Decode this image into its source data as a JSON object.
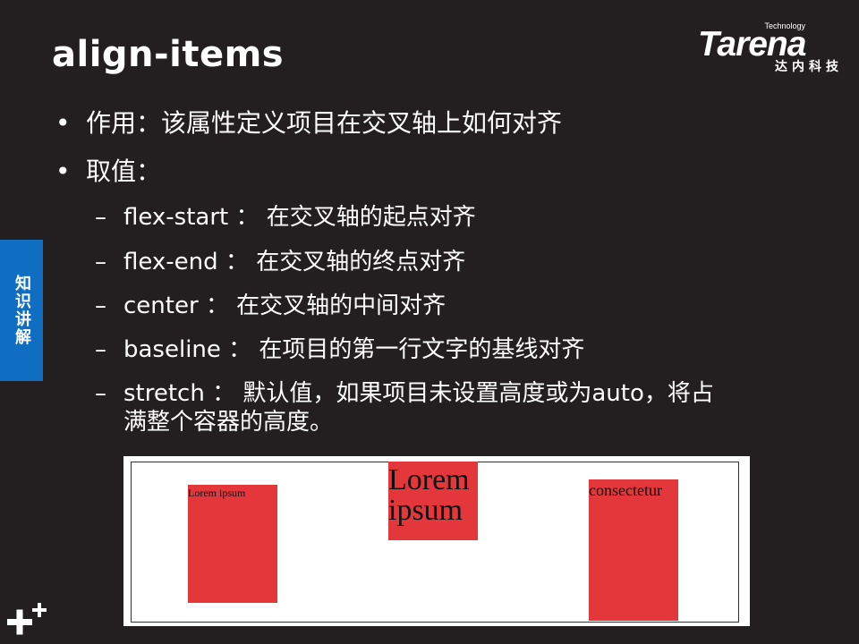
{
  "title": "align-items",
  "logo": {
    "word": "Tarena",
    "tagline": "Technology",
    "cn": "达内科技"
  },
  "sidetab": "知识讲解",
  "bullets": [
    {
      "marker": "•",
      "text": "作用：该属性定义项目在交叉轴上如何对齐"
    },
    {
      "marker": "•",
      "text": "取值："
    }
  ],
  "subitems": [
    {
      "marker": "–",
      "text": "flex-start ： 在交叉轴的起点对齐"
    },
    {
      "marker": "–",
      "text": "flex-end ： 在交叉轴的终点对齐"
    },
    {
      "marker": "–",
      "text": "center ： 在交叉轴的中间对齐"
    },
    {
      "marker": "–",
      "text": "baseline ： 在项目的第一行文字的基线对齐"
    },
    {
      "marker": "–",
      "text": "stretch ： 默认值，如果项目未设置高度或为auto，将占",
      "cont": "满整个容器的高度。"
    }
  ],
  "demo": {
    "items": [
      "Lorem ipsum",
      "Lorem ipsum",
      "consectetur"
    ],
    "box_color": "#e3373c"
  },
  "colors": {
    "background": "#231f20",
    "sidetab": "#0f6ec2",
    "text": "#ffffff"
  }
}
